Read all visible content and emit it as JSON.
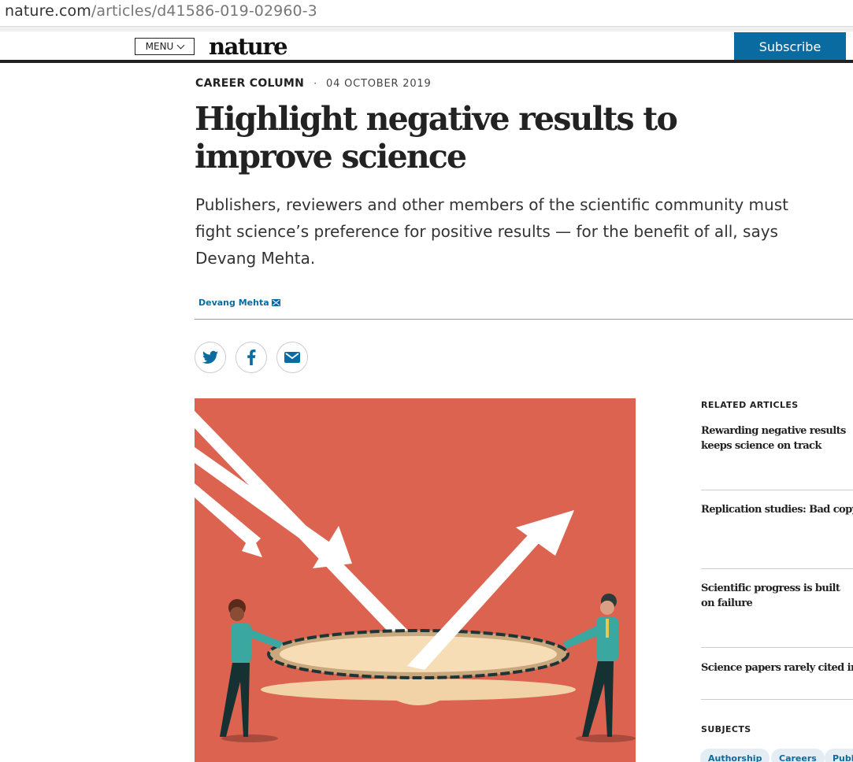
{
  "browser": {
    "url_host": "nature.com",
    "url_path": "/articles/d41586-019-02960-3"
  },
  "header": {
    "menu_label": "MENU",
    "logo": "nature",
    "subscribe_label": "Subscribe"
  },
  "article": {
    "type": "CAREER COLUMN",
    "separator": "·",
    "date": "04 OCTOBER 2019",
    "title": "Highlight negative results to improve science",
    "standfirst": "Publishers, reviewers and other members of the scientific community must fight science’s preference for positive results — for the benefit of all, says Devang Mehta.",
    "author": "Devang Mehta"
  },
  "share": {
    "icons": [
      "twitter-icon",
      "facebook-icon",
      "email-icon"
    ]
  },
  "sidebar": {
    "related_heading": "RELATED ARTICLES",
    "related": [
      "Rewarding negative results keeps science on track",
      "Replication studies: Bad copy",
      "Scientific progress is built on failure",
      "Science papers rarely cited in negative ways"
    ],
    "subjects_heading": "SUBJECTS",
    "subjects": [
      "Authorship",
      "Careers",
      "Publishing"
    ]
  },
  "colors": {
    "brand_blue": "#0a6ba0",
    "illustration_bg": "#dd6351"
  }
}
